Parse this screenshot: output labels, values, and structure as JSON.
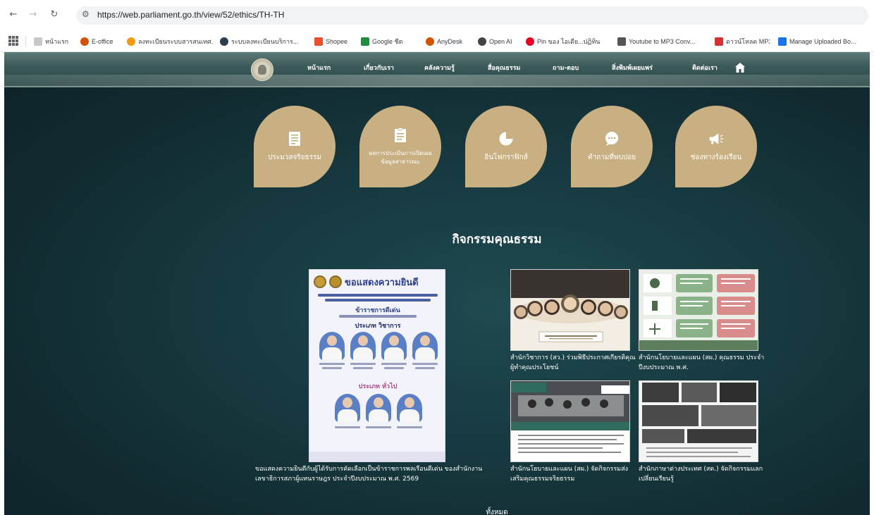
{
  "browser": {
    "url": "https://web.parliament.go.th/view/52/ethics/TH-TH",
    "bookmarks": [
      {
        "label": "หน้าแรก",
        "color": "#c8c8c8"
      },
      {
        "label": "E-office",
        "color": "#d35400"
      },
      {
        "label": "ลงทะเบียนระบบสารสนเทศ...",
        "color": "#f39c12"
      },
      {
        "label": "ระบบลงทะเบียนบริการ...",
        "color": "#2c3e50"
      },
      {
        "label": "Shopee",
        "color": "#ee4d2d"
      },
      {
        "label": "Google ชีต",
        "color": "#1e8e3e"
      },
      {
        "label": "AnyDesk",
        "color": "#d35400"
      },
      {
        "label": "Open AI",
        "color": "#444444"
      },
      {
        "label": "Pin ของ ไอเดีย...ปฏิทิน",
        "color": "#e60023"
      },
      {
        "label": "Youtube to MP3 Conv...",
        "color": "#555555"
      },
      {
        "label": "ดาวน์โหลด MP3",
        "color": "#d63031"
      },
      {
        "label": "Manage Uploaded Bo...",
        "color": "#1a73e8"
      }
    ]
  },
  "header": {
    "menu": [
      "หน้าแรก",
      "เกี่ยวกับเรา",
      "คลังความรู้",
      "สื่อคุณธรรม",
      "ถาม-ตอบ",
      "สิ่งพิมพ์เผยแพร่",
      "ติดต่อเรา"
    ]
  },
  "quick_links": [
    {
      "label": "ประมวลจริยธรรม",
      "icon": "document-icon"
    },
    {
      "label": "ผลการประเมินการเปิดเผยข้อมูลสาธารณะ",
      "icon": "clipboard-icon"
    },
    {
      "label": "อินโฟกราฟิกส์",
      "icon": "pie-chart-icon"
    },
    {
      "label": "คำถามที่พบบ่อย",
      "icon": "chat-bubble-icon"
    },
    {
      "label": "ช่องทางร้องเรียน",
      "icon": "megaphone-icon"
    }
  ],
  "activities": {
    "title": "กิจกรรมคุณธรรม",
    "poster": {
      "heading": "ขอแสดงความยินดี",
      "sub1": "ข้าราชการดีเด่น",
      "sub2": "ประเภท วิชาการ",
      "sub3": "ประเภท ทั่วไป",
      "caption": "ขอแสดงความยินดีกับผู้ได้รับการคัดเลือกเป็นข้าราชการพลเรือนดีเด่น ของสำนักงานเลขาธิการสภาผู้แทนราษฎร ประจำปีงบประมาณ พ.ศ. 2569"
    },
    "cards": [
      {
        "caption": "สำนักวิชาการ (สว.) ร่วมพิธีประกาศเกียรติคุณผู้ทำคุณประโยชน์"
      },
      {
        "caption": "สำนักนโยบายและแผน (สผ.) คุณธรรม ประจำปีงบประมาณ พ.ศ."
      },
      {
        "caption": "สำนักนโยบายและแผน (สผ.) จัดกิจกรรมส่งเสริมคุณธรรมจริยธรรม"
      },
      {
        "caption": "สำนักภาษาต่างประเทศ (สต.) จัดกิจกรรมแลกเปลี่ยนเรียนรู้"
      }
    ],
    "more": "ทั้งหมด"
  }
}
